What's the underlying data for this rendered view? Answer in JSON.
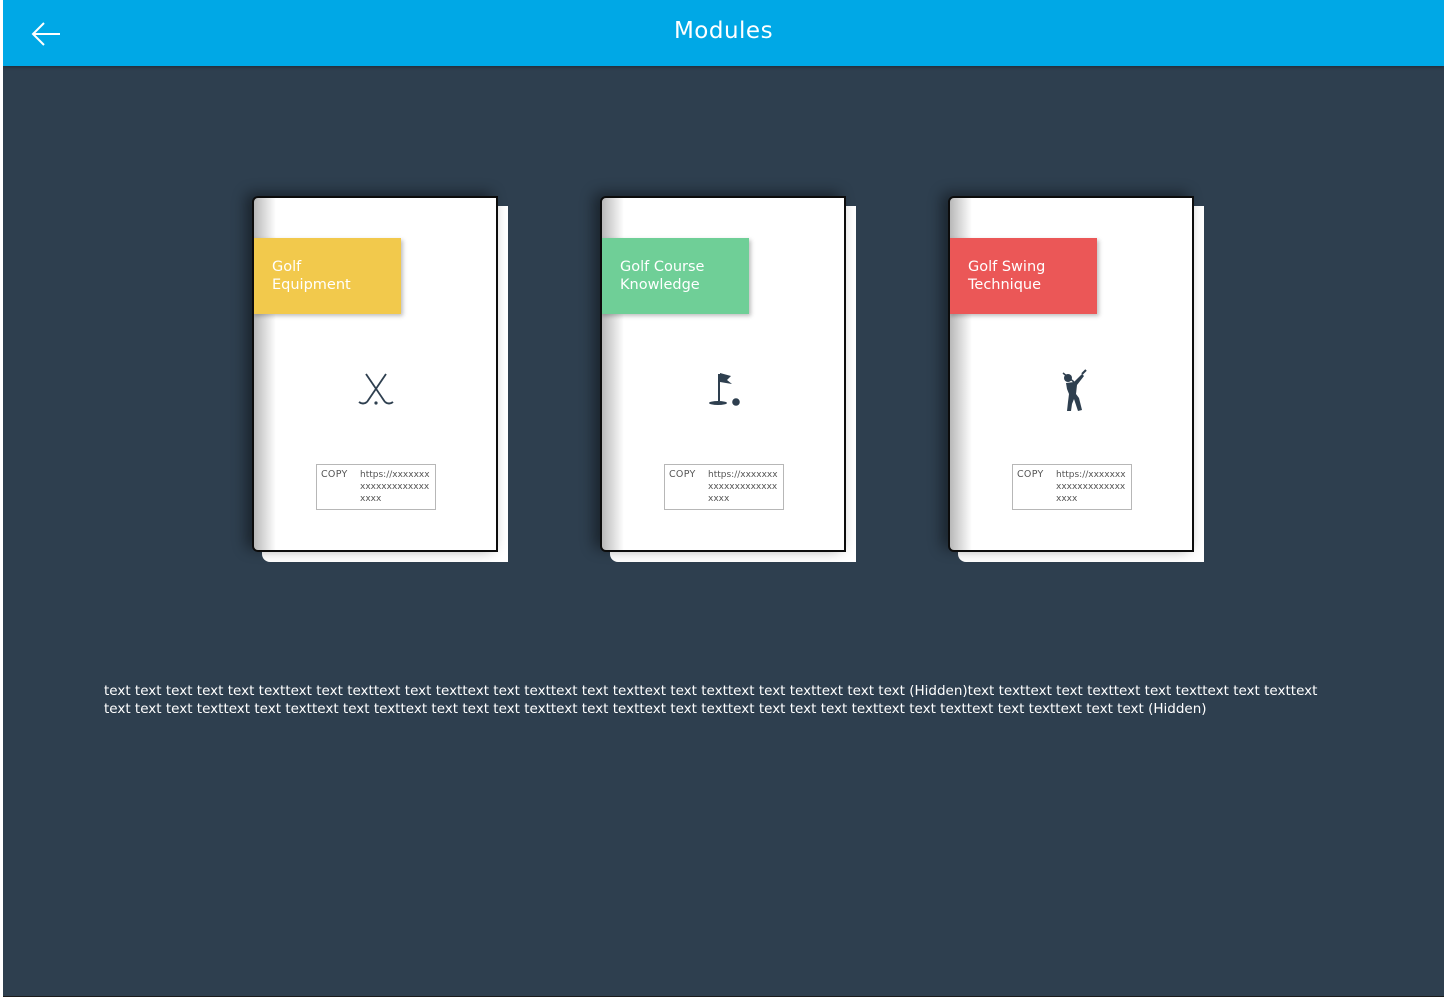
{
  "header": {
    "title": "Modules",
    "back_icon": "arrow-left-icon"
  },
  "colors": {
    "header_bg": "#00a8e6",
    "page_bg": "#2e3f4f",
    "module_1": "#f2c94c",
    "module_2": "#6fcf97",
    "module_3": "#eb5757"
  },
  "modules": [
    {
      "title_line1": "Golf",
      "title_line2": "Equipment",
      "icon": "golf-clubs-icon",
      "copy_label": "COPY",
      "url": "https://xxxxxxxxxxxxxxxxxxxxxxxx"
    },
    {
      "title_line1": "Golf Course",
      "title_line2": "Knowledge",
      "icon": "golf-hole-flag-icon",
      "copy_label": "COPY",
      "url": "https://xxxxxxxxxxxxxxxxxxxxxxxx"
    },
    {
      "title_line1": "Golf Swing",
      "title_line2": "Technique",
      "icon": "golfer-swing-icon",
      "copy_label": "COPY",
      "url": "https://xxxxxxxxxxxxxxxxxxxxxxxx"
    }
  ],
  "description": "text text text text text texttext text texttext text texttext text texttext text texttext text texttext text texttext text text (Hidden)text texttext text texttext text texttext text texttext text text text texttext text texttext text texttext text text text texttext text texttext text texttext text text text texttext text texttext text texttext text text (Hidden)"
}
